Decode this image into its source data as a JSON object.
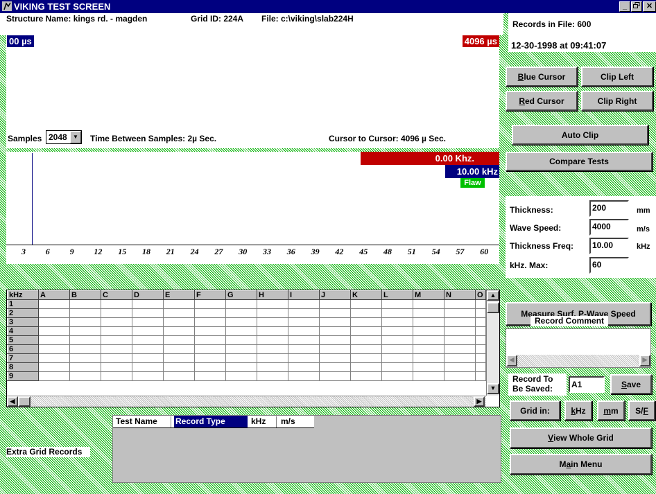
{
  "window": {
    "title": "VIKING TEST SCREEN",
    "controls": [
      "_",
      "B",
      "X"
    ]
  },
  "header": {
    "structure_name": "Structure Name: kings rd. - magden",
    "grid_id": "Grid ID: 224A",
    "file": "File: c:\\viking\\slab224H"
  },
  "waveform": {
    "start_label": "00 µs",
    "end_label": "4096 µs",
    "samples_label": "Samples",
    "samples_value": "2048",
    "time_between": "Time Between Samples: 2µ Sec.",
    "cursor_to_cursor": "Cursor to Cursor: 4096 µ Sec."
  },
  "spectrum": {
    "red_label": "0.00 Khz.",
    "blue_label": "10.00 kHz",
    "flaw_label": "Flaw",
    "ticks": [
      "3",
      "6",
      "9",
      "12",
      "15",
      "18",
      "21",
      "24",
      "27",
      "30",
      "33",
      "36",
      "39",
      "42",
      "45",
      "48",
      "51",
      "54",
      "57",
      "60"
    ]
  },
  "grid": {
    "corner": "kHz",
    "columns": [
      "A",
      "B",
      "C",
      "D",
      "E",
      "F",
      "G",
      "H",
      "I",
      "J",
      "K",
      "L",
      "M",
      "N",
      "O"
    ],
    "rows": [
      "1",
      "2",
      "3",
      "4",
      "5",
      "6",
      "7",
      "8",
      "9"
    ]
  },
  "extra": {
    "label": "Extra Grid Records",
    "columns": [
      "Test Name",
      "Record Type",
      "kHz",
      "m/s"
    ]
  },
  "right": {
    "records_in_file": "Records in File:  600",
    "datetime": "12-30-1998 at 09:41:07",
    "blue_cursor_pre": "B",
    "blue_cursor_post": "lue Cursor",
    "clip_left": "Clip Left",
    "red_cursor_pre": "R",
    "red_cursor_post": "ed Cursor",
    "clip_right": "Clip Right",
    "auto_clip": "Auto Clip",
    "compare_tests": "Compare Tests",
    "thickness_label": "Thickness:",
    "thickness_value": "200",
    "thickness_unit": "mm",
    "wave_speed_label": "Wave Speed:",
    "wave_speed_value": "4000",
    "wave_speed_unit": "m/s",
    "thickness_freq_label": "Thickness Freq:",
    "thickness_freq_value": "10.00",
    "thickness_freq_unit": "kHz",
    "khz_max_label": "kHz. Max:",
    "khz_max_value": "60",
    "measure_pre": "Measure Surf. P-",
    "measure_key": "W",
    "measure_post": "ave Speed",
    "record_comment_label": "Record Comment",
    "record_to_be_saved_1": "Record To",
    "record_to_be_saved_2": "Be Saved:",
    "record_value": "A1",
    "save_key": "S",
    "save_post": "ave",
    "grid_in": "Grid in:",
    "khz_key": "k",
    "khz_post": "Hz",
    "mm_key": "m",
    "mm_post": "m",
    "sf_pre": "S/",
    "sf_key": "F",
    "view_key": "V",
    "view_post": "iew Whole Grid",
    "main_pre": "M",
    "main_key": "a",
    "main_post": "in Menu"
  },
  "colors": {
    "titlebar": "#000080",
    "red_marker": "#c00000",
    "blue_marker": "#000080",
    "flaw": "#00c000",
    "background_hatch": "#00b000"
  }
}
